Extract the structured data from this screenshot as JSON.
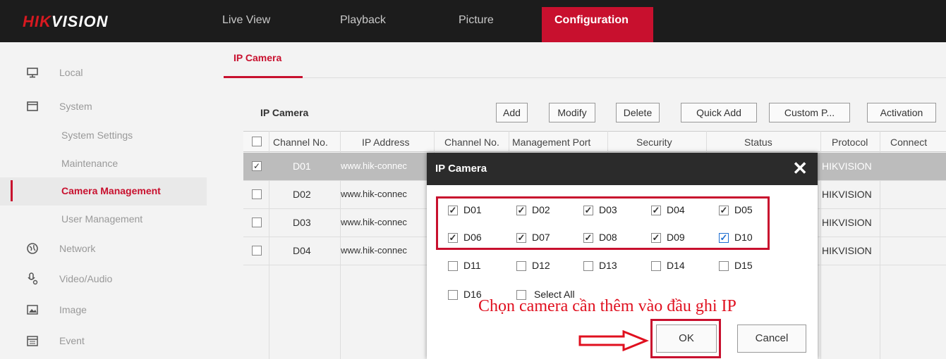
{
  "brand": {
    "logo_hik": "HIK",
    "logo_rest": "VISION"
  },
  "nav": {
    "items": [
      "Live View",
      "Playback",
      "Picture"
    ],
    "active": "Configuration"
  },
  "sidebar": {
    "items": [
      {
        "label": "Local",
        "icon": "monitor-icon"
      },
      {
        "label": "System",
        "icon": "window-icon"
      },
      {
        "label": "System Settings"
      },
      {
        "label": "Maintenance"
      },
      {
        "label": "Camera Management"
      },
      {
        "label": "User Management"
      },
      {
        "label": "Network",
        "icon": "globe-icon"
      },
      {
        "label": "Video/Audio",
        "icon": "video-audio-icon"
      },
      {
        "label": "Image",
        "icon": "image-icon"
      },
      {
        "label": "Event",
        "icon": "calendar-icon"
      }
    ]
  },
  "tab": {
    "label": "IP Camera"
  },
  "panel": {
    "title": "IP Camera",
    "buttons": [
      "Add",
      "Modify",
      "Delete",
      "Quick Add",
      "Custom P...",
      "Activation"
    ]
  },
  "table": {
    "headers": [
      "Channel No.",
      "IP Address",
      "Channel No.",
      "Management Port",
      "Security",
      "Status",
      "Protocol",
      "Connect"
    ],
    "rows": [
      {
        "channel": "D01",
        "ip": "www.hik-connec",
        "protocol": "HIKVISION",
        "checked": "✓"
      },
      {
        "channel": "D02",
        "ip": "www.hik-connec",
        "protocol": "HIKVISION"
      },
      {
        "channel": "D03",
        "ip": "www.hik-connec",
        "protocol": "HIKVISION"
      },
      {
        "channel": "D04",
        "ip": "www.hik-connec",
        "protocol": "HIKVISION"
      }
    ]
  },
  "dialog": {
    "title": "IP Camera",
    "close": "✕",
    "checkboxes": [
      {
        "label": "D01",
        "checked": "✓"
      },
      {
        "label": "D02",
        "checked": "✓"
      },
      {
        "label": "D03",
        "checked": "✓"
      },
      {
        "label": "D04",
        "checked": "✓"
      },
      {
        "label": "D05",
        "checked": "✓"
      },
      {
        "label": "D06",
        "checked": "✓"
      },
      {
        "label": "D07",
        "checked": "✓"
      },
      {
        "label": "D08",
        "checked": "✓"
      },
      {
        "label": "D09",
        "checked": "✓"
      },
      {
        "label": "D10",
        "checked": "✓"
      },
      {
        "label": "D11",
        "checked": ""
      },
      {
        "label": "D12",
        "checked": ""
      },
      {
        "label": "D13",
        "checked": ""
      },
      {
        "label": "D14",
        "checked": ""
      },
      {
        "label": "D15",
        "checked": ""
      },
      {
        "label": "D16",
        "checked": ""
      },
      {
        "label": "Select All",
        "checked": ""
      }
    ],
    "annotation": "Chọn camera cần thêm vào đầu ghi IP",
    "ok": "OK",
    "cancel": "Cancel"
  },
  "colors": {
    "accent": "#c8102e",
    "annotation": "#e0101f",
    "checkbox_blue": "#1f6fd1"
  }
}
